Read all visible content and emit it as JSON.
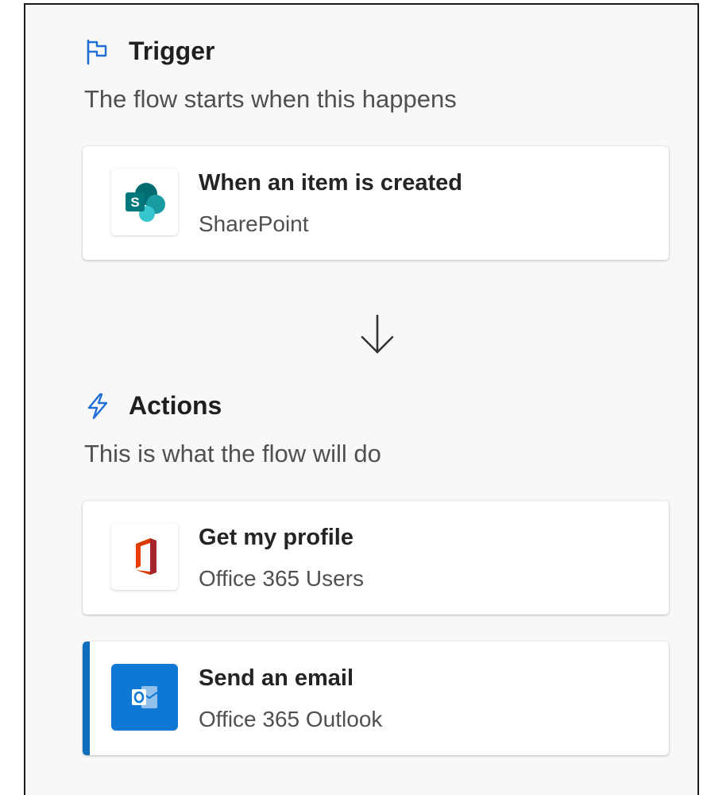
{
  "trigger": {
    "icon": "flag-icon",
    "title": "Trigger",
    "subtitle": "The flow starts when this happens",
    "card": {
      "icon": "sharepoint-logo-icon",
      "title": "When an item is created",
      "connector": "SharePoint"
    }
  },
  "flow_arrow": {
    "icon": "arrow-down-icon"
  },
  "actions": {
    "icon": "lightning-icon",
    "title": "Actions",
    "subtitle": "This is what the flow will do",
    "cards": [
      {
        "icon": "office-logo-icon",
        "title": "Get my profile",
        "connector": "Office 365 Users",
        "selected": false
      },
      {
        "icon": "outlook-logo-icon",
        "title": "Send an email",
        "connector": "Office 365 Outlook",
        "selected": true
      }
    ]
  },
  "colors": {
    "accent": "#0f6cbd",
    "panel_background": "#f8f8f8",
    "sharepoint_teal": "#038387",
    "office_red": "#d83b01",
    "outlook_blue": "#0f78d4"
  }
}
